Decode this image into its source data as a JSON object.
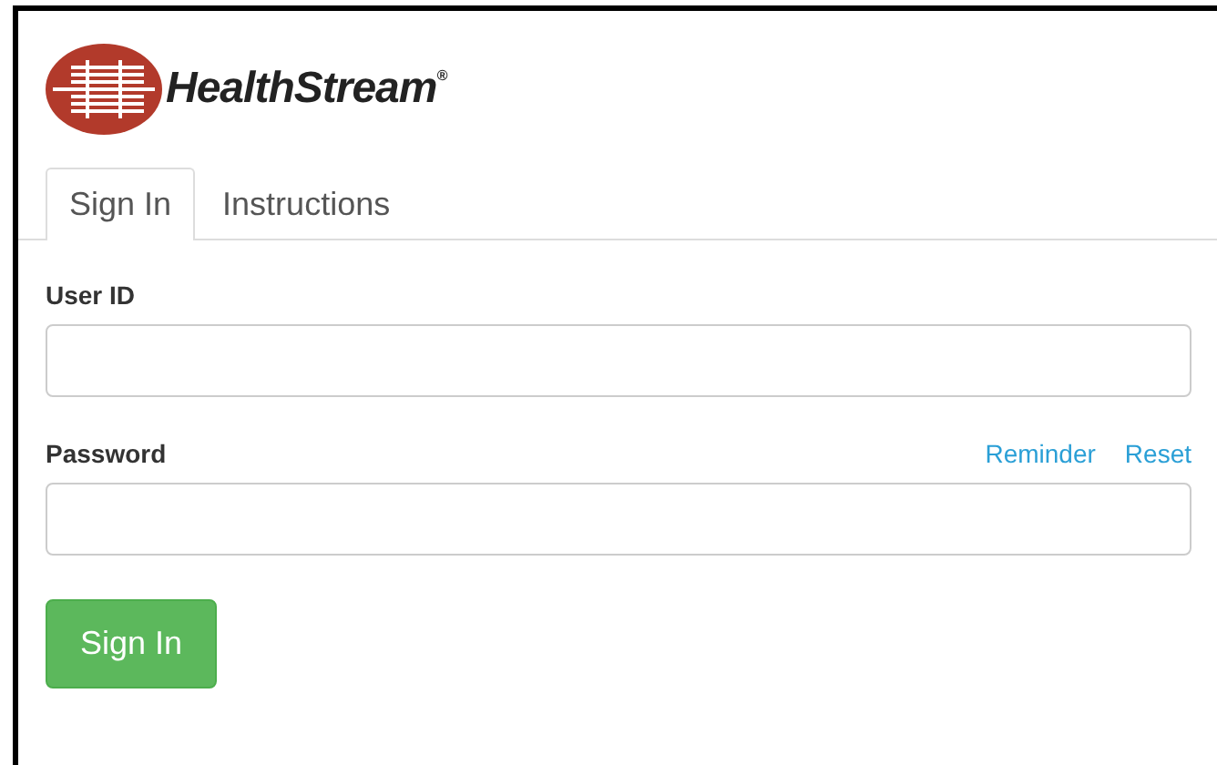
{
  "logo": {
    "text": "HealthStream$^{®}$"
  },
  "tabs": [
    {
      "label": "Sign In",
      "selected": true
    },
    {
      "label": "Instructions",
      "selected": false
    }
  ],
  "form": {
    "user_id": {
      "label": "User ID"
    },
    "password": {
      "label": "Password",
      "links": [
        "Reminder",
        "Reset"
      ]
    },
    "submit": "Sign In"
  }
}
